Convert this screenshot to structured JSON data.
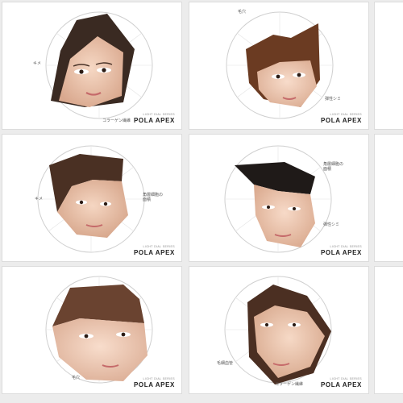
{
  "brand": {
    "tagline": "LIGHT DIAL SERIES",
    "logo": "POLA APEX"
  },
  "cards": [
    {
      "labels": {
        "left": "キメ",
        "bottom": "コラーゲン繊維"
      }
    },
    {
      "labels": {
        "top": "毛穴",
        "right": "弾性シミ"
      }
    },
    {
      "labels": {
        "left": "キメ",
        "right": "角層細胞の\n面積"
      }
    },
    {
      "labels": {
        "right_top": "角層細胞の\n面積",
        "right": "弾性シミ"
      }
    },
    {
      "labels": {
        "bottom_left": "毛穴"
      }
    },
    {
      "labels": {
        "left": "毛細血管",
        "bottom": "コラーゲン繊維"
      }
    }
  ]
}
